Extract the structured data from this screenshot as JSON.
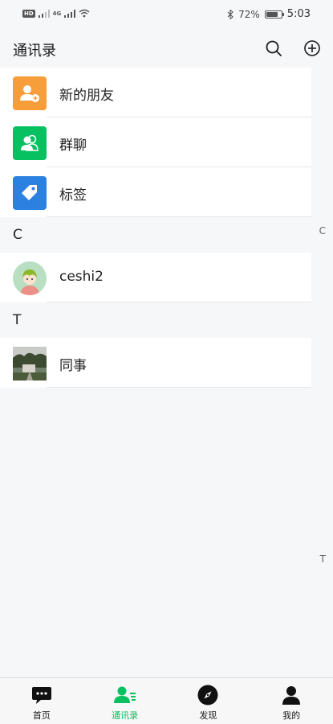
{
  "status_bar": {
    "battery": "72%",
    "time": "5:03",
    "network": "4G",
    "hd": "HD"
  },
  "header": {
    "title": "通讯录"
  },
  "top_items": [
    {
      "label": "新的朋友",
      "icon": "new-friend-icon",
      "color": "#f79d3a"
    },
    {
      "label": "群聊",
      "icon": "group-chat-icon",
      "color": "#07c160"
    },
    {
      "label": "标签",
      "icon": "tag-icon",
      "color": "#2b80e0"
    }
  ],
  "sections": [
    {
      "letter": "C",
      "contacts": [
        {
          "name": "ceshi2"
        }
      ]
    },
    {
      "letter": "T",
      "contacts": [
        {
          "name": "同事"
        }
      ]
    }
  ],
  "index_letters": [
    "C",
    "T"
  ],
  "tabbar": [
    {
      "label": "首页",
      "icon": "chat-bubble-icon",
      "active": false
    },
    {
      "label": "通讯录",
      "icon": "contacts-icon",
      "active": true
    },
    {
      "label": "发现",
      "icon": "compass-icon",
      "active": false
    },
    {
      "label": "我的",
      "icon": "profile-icon",
      "active": false
    }
  ],
  "colors": {
    "accent": "#07c160",
    "background": "#f6f7f9"
  }
}
